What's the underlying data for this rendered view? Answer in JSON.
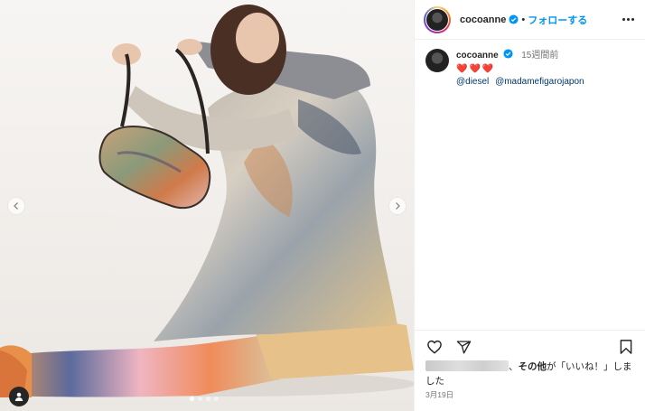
{
  "post": {
    "username": "cocoanne",
    "separator": "•",
    "follow_label": "フォローする",
    "verified_icon": "verified-badge-icon",
    "accent_color": "#0095f6"
  },
  "comment": {
    "username": "cocoanne",
    "time": "15週間前",
    "hearts": "❤️❤️❤️",
    "mentions": [
      "@diesel",
      "@madamefigarojapon"
    ]
  },
  "actions": {
    "icons": [
      "heart-icon",
      "share-icon",
      "bookmark-icon"
    ]
  },
  "likes": {
    "prefix": "、",
    "others": "その他",
    "suffix": "が「いいね！」しました"
  },
  "date": "3月19日",
  "carousel": {
    "dot_count": 4,
    "active_index": 0
  }
}
